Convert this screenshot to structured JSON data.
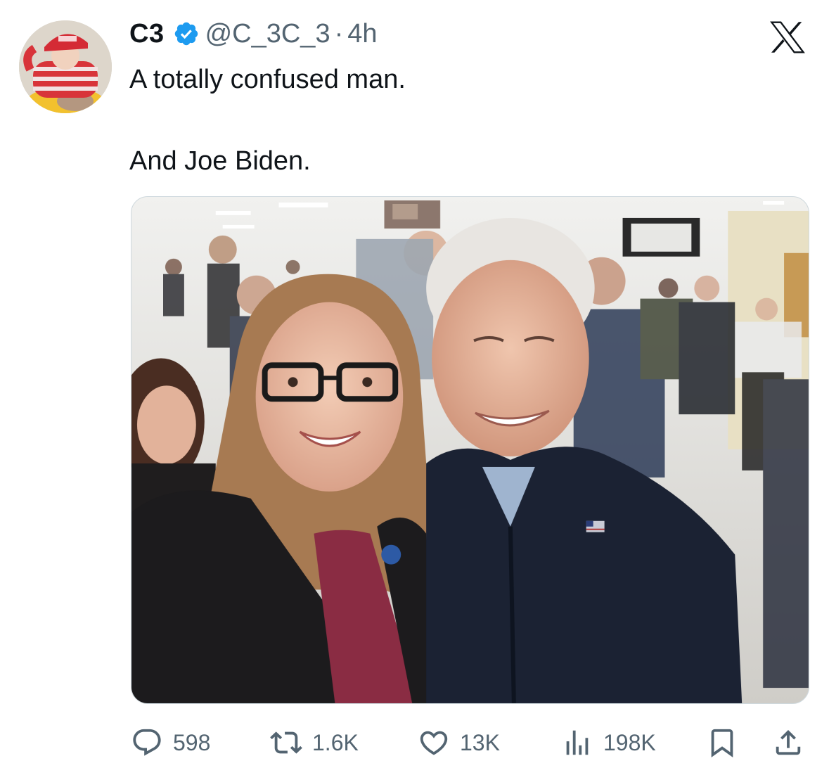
{
  "user": {
    "display_name": "C3",
    "handle": "@C_3C_3",
    "separator": "·",
    "time": "4h"
  },
  "tweet": {
    "text": "A totally confused man.\n\nAnd Joe Biden."
  },
  "actions": {
    "replies": "598",
    "reposts": "1.6K",
    "likes": "13K",
    "views": "198K"
  },
  "icons": {
    "verified": "verified-badge-icon",
    "platform": "x-logo-icon",
    "reply": "reply-icon",
    "repost": "repost-icon",
    "like": "heart-icon",
    "views": "views-chart-icon",
    "bookmark": "bookmark-icon",
    "share": "share-icon"
  },
  "colors": {
    "text": "#0f1419",
    "secondary": "#536471",
    "verified": "#1d9bf0"
  }
}
